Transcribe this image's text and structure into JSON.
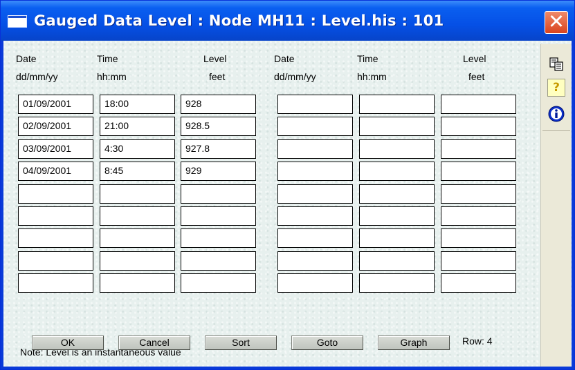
{
  "window": {
    "title": "Gauged Data Level : Node MH11 : Level.his : 101",
    "close_label": "✕"
  },
  "columns_left": [
    {
      "label": "Date",
      "unit": "dd/mm/yy"
    },
    {
      "label": "Time",
      "unit": "hh:mm"
    },
    {
      "label": "Level",
      "unit": "feet"
    }
  ],
  "columns_right": [
    {
      "label": "Date",
      "unit": "dd/mm/yy"
    },
    {
      "label": "Time",
      "unit": "hh:mm"
    },
    {
      "label": "Level",
      "unit": "feet"
    }
  ],
  "rows_left": [
    [
      "01/09/2001",
      "18:00",
      "928"
    ],
    [
      "02/09/2001",
      "21:00",
      "928.5"
    ],
    [
      "03/09/2001",
      "4:30",
      "927.8"
    ],
    [
      "04/09/2001",
      "8:45",
      "929"
    ],
    [
      "",
      "",
      ""
    ],
    [
      "",
      "",
      ""
    ],
    [
      "",
      "",
      ""
    ],
    [
      "",
      "",
      ""
    ],
    [
      "",
      "",
      ""
    ]
  ],
  "rows_right": [
    [
      "",
      "",
      ""
    ],
    [
      "",
      "",
      ""
    ],
    [
      "",
      "",
      ""
    ],
    [
      "",
      "",
      ""
    ],
    [
      "",
      "",
      ""
    ],
    [
      "",
      "",
      ""
    ],
    [
      "",
      "",
      ""
    ],
    [
      "",
      "",
      ""
    ],
    [
      "",
      "",
      ""
    ]
  ],
  "note": "Note: Level is an instantaneous value",
  "buttons": {
    "ok": "OK",
    "cancel": "Cancel",
    "sort": "Sort",
    "goto": "Goto",
    "graph": "Graph"
  },
  "row_indicator": "Row:  4",
  "sidebar": {
    "icons": [
      "copy-icon",
      "help-icon",
      "info-icon"
    ],
    "help_glyph": "?",
    "info_glyph": "i"
  },
  "colors": {
    "titlebar": "#0550e6",
    "close": "#d9431d",
    "client_bg": "#e7f0ee"
  }
}
